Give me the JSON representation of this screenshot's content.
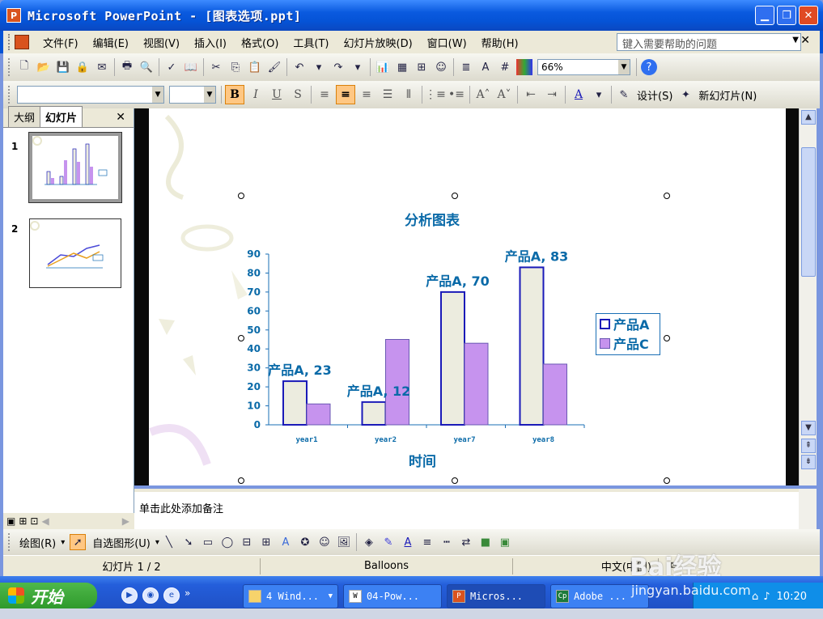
{
  "window": {
    "title": "Microsoft PowerPoint - [图表选项.ppt]",
    "app_icon": "P"
  },
  "menubar": {
    "items": [
      "文件(F)",
      "编辑(E)",
      "视图(V)",
      "插入(I)",
      "格式(O)",
      "工具(T)",
      "幻灯片放映(D)",
      "窗口(W)",
      "帮助(H)"
    ],
    "help_placeholder": "键入需要帮助的问题"
  },
  "toolbar": {
    "zoom": "66%",
    "design_label": "设计(S)",
    "new_slide_label": "新幻灯片(N)"
  },
  "leftpane": {
    "tabs": [
      "大纲",
      "幻灯片"
    ],
    "slides": [
      "1",
      "2"
    ]
  },
  "chart_data": {
    "type": "bar",
    "title": "分析图表",
    "xlabel": "时间",
    "ylabel": "",
    "categories": [
      "year1",
      "year2",
      "year7",
      "year8"
    ],
    "series": [
      {
        "name": "产品A",
        "values": [
          23,
          12,
          70,
          83
        ],
        "color": "#ececdf",
        "stroke": "#1a1ab8"
      },
      {
        "name": "产品C",
        "values": [
          11,
          45,
          43,
          32
        ],
        "color": "#c693ee",
        "stroke": "#6a58b3"
      }
    ],
    "yticks": [
      0,
      10,
      20,
      30,
      40,
      50,
      60,
      70,
      80,
      90
    ],
    "ylim": [
      0,
      90
    ],
    "data_labels": [
      "产品A,  23",
      "产品A,  12",
      "产品A,  70",
      "产品A,  83"
    ],
    "legend": "right"
  },
  "notes": {
    "placeholder": "单击此处添加备注"
  },
  "drawbar": {
    "draw_label": "绘图(R)",
    "autoshape_label": "自选图形(U)"
  },
  "statusbar": {
    "slide": "幻灯片 1 / 2",
    "template": "Balloons",
    "language": "中文(中国)"
  },
  "taskbar": {
    "start_label": "开始",
    "items": [
      "4 Wind...",
      "04-Pow...",
      "Micros...",
      "Adobe ..."
    ],
    "clock": "10:20"
  },
  "watermark": {
    "brand": "Bai经验",
    "url": "jingyan.baidu.com"
  }
}
